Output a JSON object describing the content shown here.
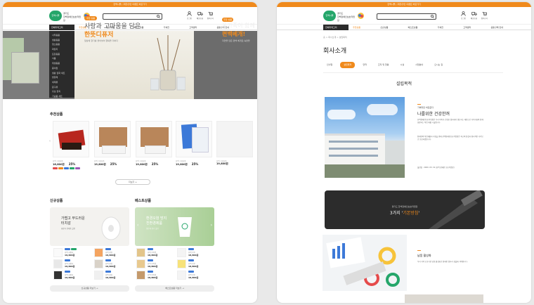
{
  "colors": {
    "accent": "#f08a1c",
    "dark": "#2b2b2b",
    "green": "#25a66a",
    "tag_blue": "#3c79d8"
  },
  "common": {
    "topbar_text": "한백시몰 | 쿠폰/할인 이벤트 바로가기",
    "logo": {
      "pill": "한백시몰",
      "line1": "경기도",
      "line2": "한백장애인보호작업장"
    },
    "icons": [
      {
        "icon": "user-icon",
        "label": "로그인"
      },
      {
        "icon": "truck-icon",
        "label": "배송조회"
      },
      {
        "icon": "cart-icon",
        "label": "장바구니"
      }
    ],
    "category_button": "전체카테고리",
    "nav": [
      "추천상품",
      "신규상품",
      "베스트상품",
      "기획전",
      "고객센터"
    ],
    "nav_right": "공동구매 안내",
    "nav_active_index": 0
  },
  "left": {
    "category_menu": [
      "사무용품",
      "생활용품",
      "청소용품",
      "화장지",
      "포장용품",
      "식품",
      "위생용품",
      "종이컵",
      "생활 잡화 세트",
      "방향제",
      "세제류",
      "문구류",
      "홍보 판촉",
      "기념품 세트"
    ],
    "hero": {
      "badge": "추천 상품",
      "line1": "사랑과 고마움을 담은",
      "line2": "한뜻디퓨저",
      "sub": "일상에 향기를 불어넣어 행복을 더하다",
      "right_badge": "추천 상품",
      "right_line1": "온가족이 함께",
      "right_line2": "편백베개!",
      "right_sub": "자연을 담은 편백 베개로 숙면을"
    },
    "recommended": {
      "title": "추천상품",
      "products": [
        {
          "brand": "한백 기획상품",
          "price": "16,800원",
          "discount": "25%"
        },
        {
          "brand": "한백 기획상품",
          "price": "19,800원",
          "discount": "25%"
        },
        {
          "brand": "한백 기획상품",
          "price": "19,800원",
          "discount": "25%"
        },
        {
          "brand": "한백 기획상품",
          "price": "19,800원",
          "discount": "25%"
        },
        {
          "brand": "한백 기획상품",
          "price": "19,800원",
          "discount": "25%"
        }
      ],
      "more": "더보기 +"
    },
    "new": {
      "title": "신규상품",
      "banner_line1": "가볍고 부드러운",
      "banner_line2": "터치감",
      "banner_sub": "화장지 전제품 할인",
      "items": [
        {
          "name": "한백 화장지",
          "price": "19,600원"
        },
        {
          "name": "한백 장갑",
          "price": "19,600원"
        },
        {
          "name": "한백 화장지",
          "price": "19,600원"
        },
        {
          "name": "한백 장갑",
          "price": "19,600원"
        },
        {
          "name": "한백 화장지",
          "price": "19,600원"
        },
        {
          "name": "한백 장갑",
          "price": "19,600원"
        }
      ],
      "more": "신규상품 더보기 →"
    },
    "best": {
      "title": "베스트상품",
      "banner_line1": "환경오염 방지",
      "banner_line2": "친환경제품",
      "banner_sub": "생분해 용기 할인",
      "items": [
        {
          "name": "한백 종이컵",
          "price": "18,800원"
        },
        {
          "name": "한백 봉투",
          "price": "18,800원"
        },
        {
          "name": "한백 종이컵",
          "price": "18,800원"
        },
        {
          "name": "한백 봉투",
          "price": "18,800원"
        },
        {
          "name": "한백 종이컵",
          "price": "18,800원"
        },
        {
          "name": "한백 봉투",
          "price": "18,800원"
        }
      ],
      "more": "베스트상품 더보기 →"
    }
  },
  "right": {
    "breadcrumb": "홈 > 회사소개 > 설립목적",
    "title": "회사소개",
    "tabs": [
      "인사말",
      "설립목적",
      "연혁",
      "조직 및 현황",
      "시설",
      "사업분야",
      "오시는 길"
    ],
    "active_tab": 1,
    "section_title": "설립목적",
    "sub_small": "가벼지만 바로준다",
    "sub_title": "나를위한 건강한꺼",
    "para1": "한백장애인보호작업장은 우리 아이가 건강한 일터에서 생산하는 제품으로 지역사회와 함께 성장하는 직업 재활 시설입니다.",
    "para2": "장애인의 직업재활과 자립을 위해 한백장애인보호작업장은 최고의 품질과 합리적인 가격으로 보답하겠습니다.",
    "para3": "설립일 : 2000. 03. 19 (한백 장애인 보호작업장)",
    "dark_small": "경기도 한백장애인보호작업장",
    "dark_main": "3가지",
    "dark_accent": "기본방침",
    "sub3": "납품 활성화",
    "para4": "우리 지역 공공기관 납품 활성화로 장애인 일자리 창출에 기여합니다."
  }
}
